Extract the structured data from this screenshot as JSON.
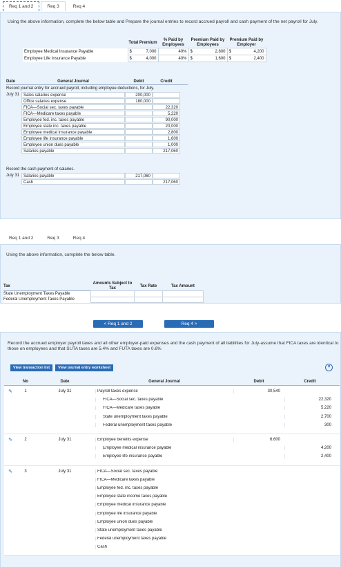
{
  "top_tabs": [
    "Req 1 and 2",
    "Req 3",
    "Req 4"
  ],
  "top_instruction": "Using the above information, complete the below table and Prepare the journal entries to record accrued payroll and cash payment of the net payroll for July.",
  "premium_table": {
    "headers": [
      "Total Premium",
      "% Paid by Employees",
      "Premium Paid by Employees",
      "Premium Paid by Employer"
    ],
    "rows": [
      {
        "label": "Employee Medical Insurance Payable",
        "total": "7,000",
        "pct": "40%",
        "by_emp": "2,800",
        "by_employer": "4,200"
      },
      {
        "label": "Employee Life Insurance Payable",
        "total": "4,000",
        "pct": "40%",
        "by_emp": "1,600",
        "by_employer": "2,400"
      }
    ],
    "currency": "$"
  },
  "journal1": {
    "headers": {
      "date": "Date",
      "gj": "General Journal",
      "debit": "Debit",
      "credit": "Credit"
    },
    "note1": "Record journal entry for accrued payroll, including employee deductions, for July.",
    "date1": "July 31",
    "entries1": [
      {
        "account": "Sales salaries expense",
        "debit": "200,000",
        "credit": ""
      },
      {
        "account": "Office salaries expense",
        "debit": "180,000",
        "credit": ""
      },
      {
        "account": "FICA—Social sec. taxes payable",
        "debit": "",
        "credit": "22,320"
      },
      {
        "account": "FICA—Medicare taxes payable",
        "debit": "",
        "credit": "5,220"
      },
      {
        "account": "Employee fed. inc. taxes payable",
        "debit": "",
        "credit": "90,000"
      },
      {
        "account": "Employee state inc. taxes payable",
        "debit": "",
        "credit": "20,000"
      },
      {
        "account": "Employee medical insurance payable",
        "debit": "",
        "credit": "2,800"
      },
      {
        "account": "Employee life insurance payable",
        "debit": "",
        "credit": "1,600"
      },
      {
        "account": "Employee union dues payable",
        "debit": "",
        "credit": "1,000"
      },
      {
        "account": "Salaries payable",
        "debit": "",
        "credit": "217,060"
      }
    ],
    "note2": "Record the cash payment of salaries.",
    "date2": "July 31",
    "entries2": [
      {
        "account": "Salaries payable",
        "debit": "217,060",
        "credit": ""
      },
      {
        "account": "Cash",
        "debit": "",
        "credit": "217,060"
      }
    ]
  },
  "mid_tabs": [
    "Req 1 and 2",
    "Req 3",
    "Req 4"
  ],
  "mid_instruction": "Using the above information, complete the below table.",
  "tax_table": {
    "headers": [
      "Tax",
      "Amounts Subject to Tax",
      "Tax Rate",
      "Tax Amount"
    ],
    "rows": [
      "State Unemployment Taxes Payable",
      "Federal Unemployment Taxes Payable"
    ]
  },
  "nav": {
    "prev": "< Req 1 and 2",
    "next": "Req 4 >"
  },
  "bottom_instruction": "Record the accrued employer payroll taxes and all other employer-paid expenses and the cash payment of all liabilities for July-assume that FICA taxes are identical to those on employees and that SUTA taxes are 5.4% and FUTA taxes are 0.6%",
  "buttons": {
    "view_transactions": "View transaction list",
    "view_worksheet": "View journal entry worksheet"
  },
  "journal2": {
    "headers": {
      "no": "No",
      "date": "Date",
      "gj": "General Journal",
      "debit": "Debit",
      "credit": "Credit"
    },
    "groups": [
      {
        "no": "1",
        "date": "July 31",
        "lines": [
          {
            "account": "Payroll taxes expense",
            "indent": false,
            "debit": "30,540",
            "credit": ""
          },
          {
            "account": "FICA—Social sec. taxes payable",
            "indent": true,
            "debit": "",
            "credit": "22,320"
          },
          {
            "account": "FICA—Medicare taxes payable",
            "indent": true,
            "debit": "",
            "credit": "5,220"
          },
          {
            "account": "State unemployment taxes payable",
            "indent": true,
            "debit": "",
            "credit": "2,700"
          },
          {
            "account": "Federal unemployment taxes payable",
            "indent": true,
            "debit": "",
            "credit": "300"
          }
        ]
      },
      {
        "no": "2",
        "date": "July 31",
        "lines": [
          {
            "account": "Employee benefits expense",
            "indent": false,
            "debit": "6,600",
            "credit": ""
          },
          {
            "account": "Employee medical insurance payable",
            "indent": true,
            "debit": "",
            "credit": "4,200"
          },
          {
            "account": "Employee life insurance payable",
            "indent": true,
            "debit": "",
            "credit": "2,400"
          }
        ]
      },
      {
        "no": "3",
        "date": "July 31",
        "lines": [
          {
            "account": "FICA—Social sec. taxes payable",
            "indent": false,
            "debit": "",
            "credit": ""
          },
          {
            "account": "FICA—Medicare taxes payable",
            "indent": false,
            "debit": "",
            "credit": ""
          },
          {
            "account": "Employee fed. inc. taxes payable",
            "indent": false,
            "debit": "",
            "credit": ""
          },
          {
            "account": "Employee state income taxes payable",
            "indent": false,
            "debit": "",
            "credit": ""
          },
          {
            "account": "Employee medical insurance payable",
            "indent": false,
            "debit": "",
            "credit": ""
          },
          {
            "account": "Employee life insurance payable",
            "indent": false,
            "debit": "",
            "credit": ""
          },
          {
            "account": "Employee union dues payable",
            "indent": false,
            "debit": "",
            "credit": ""
          },
          {
            "account": "State unemployment taxes payable",
            "indent": false,
            "debit": "",
            "credit": ""
          },
          {
            "account": "Federal unemployment taxes payable",
            "indent": false,
            "debit": "",
            "credit": ""
          },
          {
            "account": "Cash",
            "indent": false,
            "debit": "",
            "credit": ""
          }
        ]
      }
    ]
  }
}
